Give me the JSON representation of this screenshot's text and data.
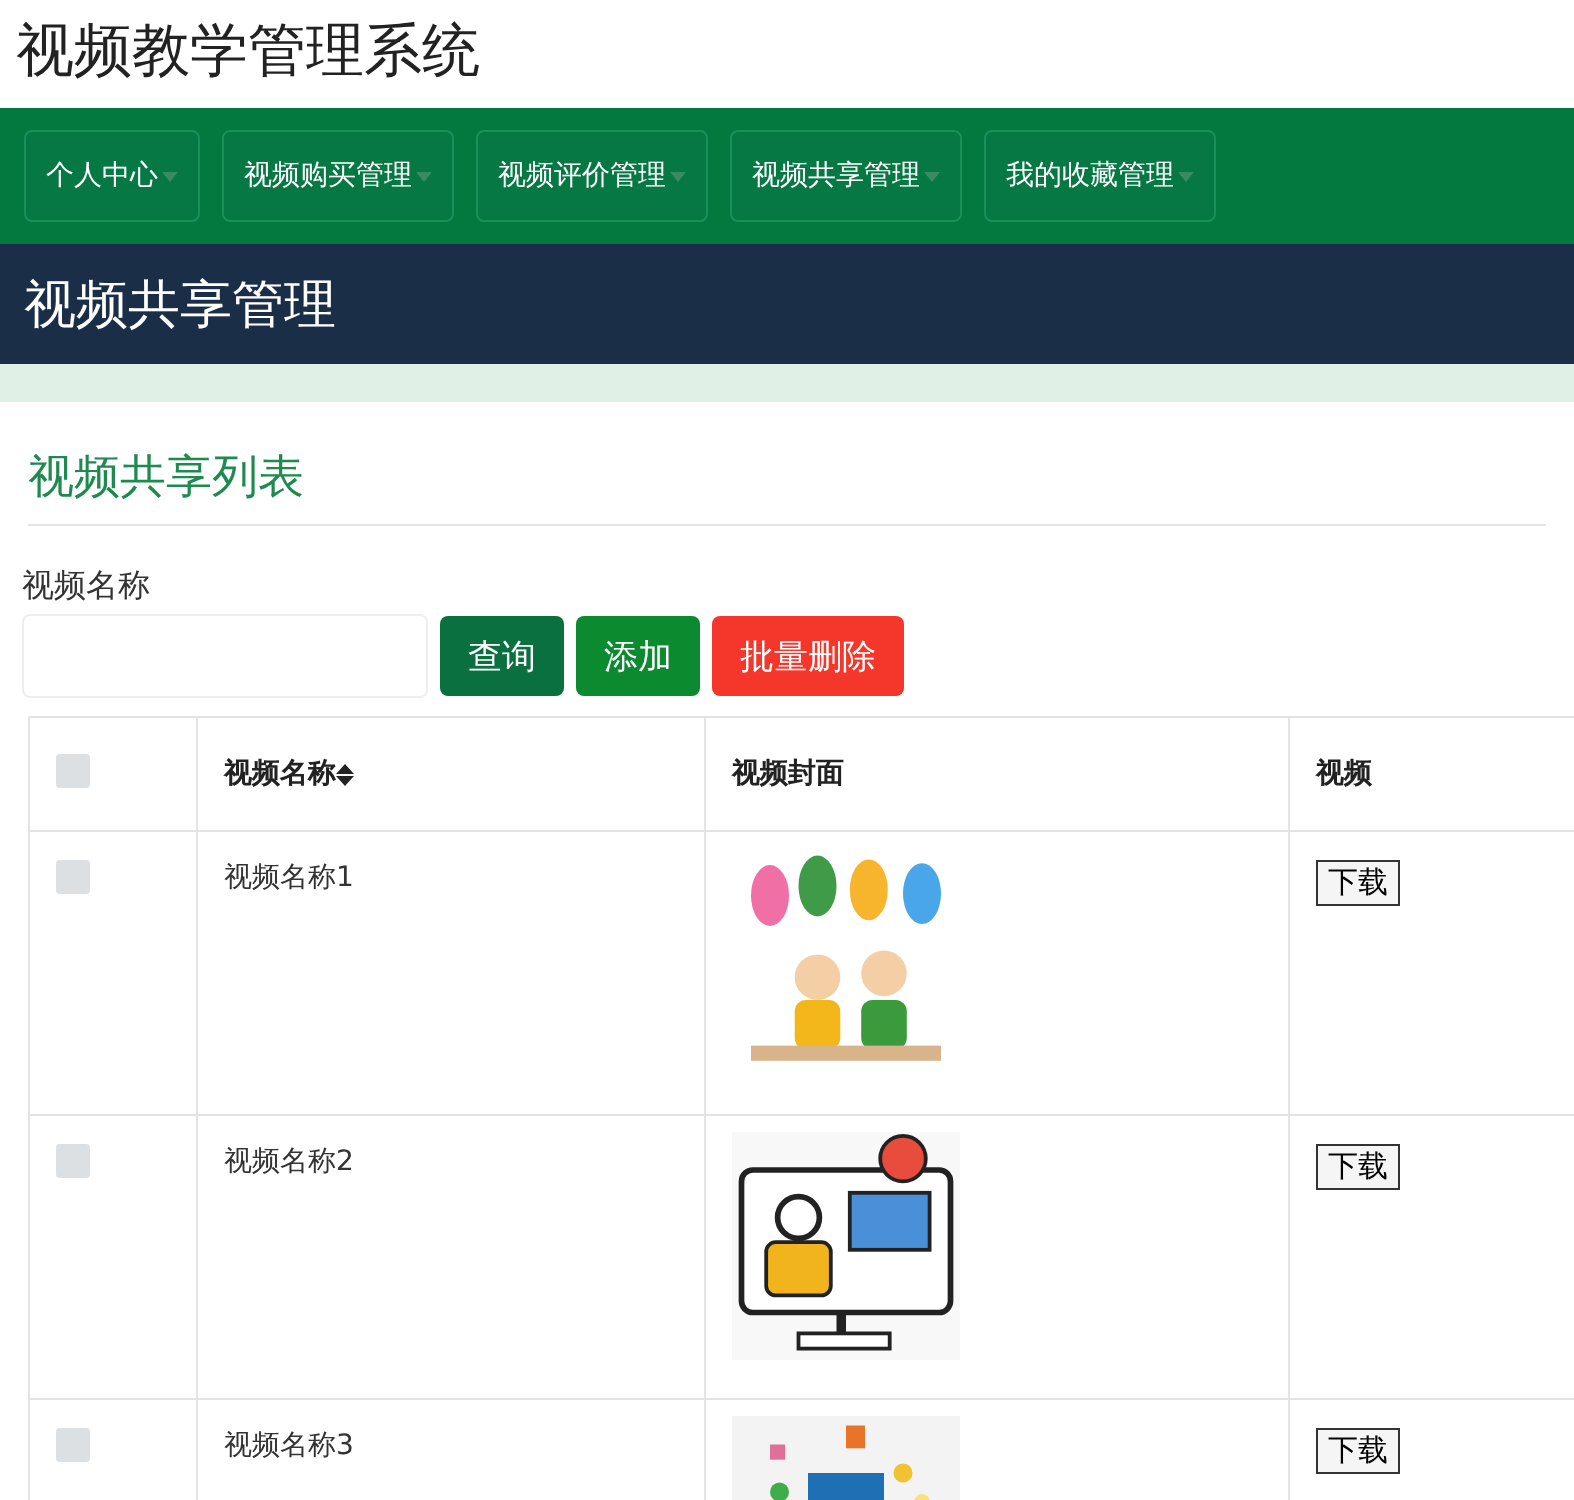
{
  "site_title": "视频教学管理系统",
  "nav": [
    {
      "label": "个人中心"
    },
    {
      "label": "视频购买管理"
    },
    {
      "label": "视频评价管理"
    },
    {
      "label": "视频共享管理"
    },
    {
      "label": "我的收藏管理"
    }
  ],
  "page_heading": "视频共享管理",
  "section_title": "视频共享列表",
  "search": {
    "label": "视频名称"
  },
  "buttons": [
    {
      "label": "查询",
      "kind": "query"
    },
    {
      "label": "添加",
      "kind": "add"
    },
    {
      "label": "批量删除",
      "kind": "delete"
    }
  ],
  "table": {
    "select_all_checked": false,
    "columns": [
      "视频名称",
      "视频封面",
      "视频"
    ],
    "rows": [
      {
        "checked": false,
        "name": "视频名称1",
        "action": "下载"
      },
      {
        "checked": false,
        "name": "视频名称2",
        "action": "下载"
      },
      {
        "checked": false,
        "name": "视频名称3",
        "action": "下载"
      }
    ]
  }
}
